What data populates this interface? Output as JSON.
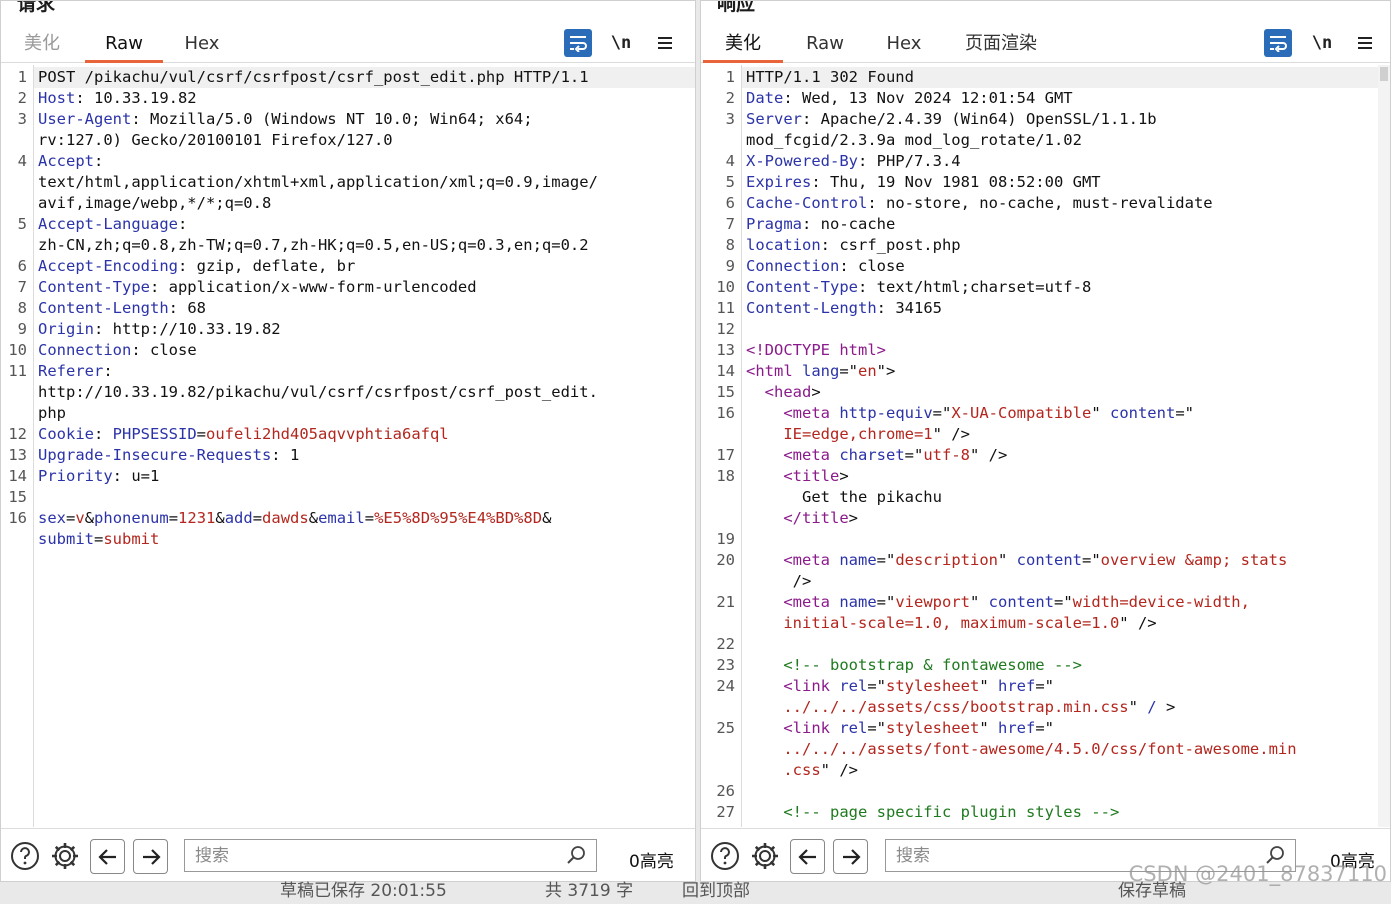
{
  "request": {
    "title": "请求",
    "tabs": [
      "美化",
      "Raw",
      "Hex"
    ],
    "active_tab": "Raw",
    "tool_newline": "\\n",
    "search_placeholder": "搜索",
    "highlight_count": "0高亮",
    "lines": [
      {
        "n": "1",
        "segs": [
          [
            "POST /pikachu/vul/csrf/csrfpost/csrf_post_edit.php HTTP/1.1",
            ""
          ]
        ]
      },
      {
        "n": "2",
        "segs": [
          [
            "Host",
            "hk"
          ],
          [
            ": 10.33.19.82",
            ""
          ]
        ]
      },
      {
        "n": "3",
        "segs": [
          [
            "User-Agent",
            "hk"
          ],
          [
            ": Mozilla/5.0 (Windows NT 10.0; Win64; x64;",
            ""
          ]
        ]
      },
      {
        "n": "",
        "segs": [
          [
            "rv:127.0) Gecko/20100101 Firefox/127.0",
            ""
          ]
        ]
      },
      {
        "n": "4",
        "segs": [
          [
            "Accept",
            "hk"
          ],
          [
            ":",
            ""
          ]
        ]
      },
      {
        "n": "",
        "segs": [
          [
            "text/html,application/xhtml+xml,application/xml;q=0.9,image/",
            ""
          ]
        ]
      },
      {
        "n": "",
        "segs": [
          [
            "avif,image/webp,*/*;q=0.8",
            ""
          ]
        ]
      },
      {
        "n": "5",
        "segs": [
          [
            "Accept-Language",
            "hk"
          ],
          [
            ":",
            ""
          ]
        ]
      },
      {
        "n": "",
        "segs": [
          [
            "zh-CN,zh;q=0.8,zh-TW;q=0.7,zh-HK;q=0.5,en-US;q=0.3,en;q=0.2",
            ""
          ]
        ]
      },
      {
        "n": "6",
        "segs": [
          [
            "Accept-Encoding",
            "hk"
          ],
          [
            ": gzip, deflate, br",
            ""
          ]
        ]
      },
      {
        "n": "7",
        "segs": [
          [
            "Content-Type",
            "hk"
          ],
          [
            ": application/x-www-form-urlencoded",
            ""
          ]
        ]
      },
      {
        "n": "8",
        "segs": [
          [
            "Content-Length",
            "hk"
          ],
          [
            ": 68",
            ""
          ]
        ]
      },
      {
        "n": "9",
        "segs": [
          [
            "Origin",
            "hk"
          ],
          [
            ": http://10.33.19.82",
            ""
          ]
        ]
      },
      {
        "n": "10",
        "segs": [
          [
            "Connection",
            "hk"
          ],
          [
            ": close",
            ""
          ]
        ]
      },
      {
        "n": "11",
        "segs": [
          [
            "Referer",
            "hk"
          ],
          [
            ":",
            ""
          ]
        ]
      },
      {
        "n": "",
        "segs": [
          [
            "http://10.33.19.82/pikachu/vul/csrf/csrfpost/csrf_post_edit.",
            ""
          ]
        ]
      },
      {
        "n": "",
        "segs": [
          [
            "php",
            ""
          ]
        ]
      },
      {
        "n": "12",
        "segs": [
          [
            "Cookie",
            "hk"
          ],
          [
            ": ",
            ""
          ],
          [
            "PHPSESSID",
            "pk"
          ],
          [
            "=",
            ""
          ],
          [
            "oufeli2hd405aqvvphtia6afql",
            "pv"
          ]
        ]
      },
      {
        "n": "13",
        "segs": [
          [
            "Upgrade-Insecure-Requests",
            "hk"
          ],
          [
            ": 1",
            ""
          ]
        ]
      },
      {
        "n": "14",
        "segs": [
          [
            "Priority",
            "hk"
          ],
          [
            ": u=1",
            ""
          ]
        ]
      },
      {
        "n": "15",
        "segs": [
          [
            "",
            ""
          ]
        ]
      },
      {
        "n": "16",
        "segs": [
          [
            "sex",
            "pk"
          ],
          [
            "=",
            ""
          ],
          [
            "v",
            "pv"
          ],
          [
            "&",
            ""
          ],
          [
            "phonenum",
            "pk"
          ],
          [
            "=",
            ""
          ],
          [
            "1231",
            "pv"
          ],
          [
            "&",
            ""
          ],
          [
            "add",
            "pk"
          ],
          [
            "=",
            ""
          ],
          [
            "dawds",
            "pv"
          ],
          [
            "&",
            ""
          ],
          [
            "email",
            "pk"
          ],
          [
            "=",
            ""
          ],
          [
            "%E5%8D%95%E4%BD%8D",
            "pv"
          ],
          [
            "&",
            ""
          ]
        ]
      },
      {
        "n": "",
        "segs": [
          [
            "submit",
            "pk"
          ],
          [
            "=",
            ""
          ],
          [
            "submit",
            "pv"
          ]
        ]
      }
    ]
  },
  "response": {
    "title": "响应",
    "tabs": [
      "美化",
      "Raw",
      "Hex",
      "页面渲染"
    ],
    "active_tab": "美化",
    "tool_newline": "\\n",
    "search_placeholder": "搜索",
    "highlight_count": "0高亮",
    "lines": [
      {
        "n": "1",
        "segs": [
          [
            "HTTP/1.1 302 Found",
            ""
          ]
        ]
      },
      {
        "n": "2",
        "segs": [
          [
            "Date",
            "hk"
          ],
          [
            ": Wed, 13 Nov 2024 12:01:54 GMT",
            ""
          ]
        ]
      },
      {
        "n": "3",
        "segs": [
          [
            "Server",
            "hk"
          ],
          [
            ": Apache/2.4.39 (Win64) OpenSSL/1.1.1b",
            ""
          ]
        ]
      },
      {
        "n": "",
        "segs": [
          [
            "mod_fcgid/2.3.9a mod_log_rotate/1.02",
            ""
          ]
        ]
      },
      {
        "n": "4",
        "segs": [
          [
            "X-Powered-By",
            "hk"
          ],
          [
            ": PHP/7.3.4",
            ""
          ]
        ]
      },
      {
        "n": "5",
        "segs": [
          [
            "Expires",
            "hk"
          ],
          [
            ": Thu, 19 Nov 1981 08:52:00 GMT",
            ""
          ]
        ]
      },
      {
        "n": "6",
        "segs": [
          [
            "Cache-Control",
            "hk"
          ],
          [
            ": no-store, no-cache, must-revalidate",
            ""
          ]
        ]
      },
      {
        "n": "7",
        "segs": [
          [
            "Pragma",
            "hk"
          ],
          [
            ": no-cache",
            ""
          ]
        ]
      },
      {
        "n": "8",
        "segs": [
          [
            "location",
            "hk"
          ],
          [
            ": csrf_post.php",
            ""
          ]
        ]
      },
      {
        "n": "9",
        "segs": [
          [
            "Connection",
            "hk"
          ],
          [
            ": close",
            ""
          ]
        ]
      },
      {
        "n": "10",
        "segs": [
          [
            "Content-Type",
            "hk"
          ],
          [
            ": text/html;charset=utf-8",
            ""
          ]
        ]
      },
      {
        "n": "11",
        "segs": [
          [
            "Content-Length",
            "hk"
          ],
          [
            ": 34165",
            ""
          ]
        ]
      },
      {
        "n": "12",
        "segs": [
          [
            "",
            ""
          ]
        ]
      },
      {
        "n": "13",
        "segs": [
          [
            "<!DOCTYPE html>",
            "tg"
          ]
        ]
      },
      {
        "n": "14",
        "segs": [
          [
            "<html ",
            "tg"
          ],
          [
            "lang",
            "at"
          ],
          [
            "=\"",
            ""
          ],
          [
            "en",
            "av"
          ],
          [
            "\">",
            ""
          ]
        ]
      },
      {
        "n": "15",
        "segs": [
          [
            "  ",
            ""
          ],
          [
            "<head",
            "tg"
          ],
          [
            ">",
            ""
          ]
        ]
      },
      {
        "n": "16",
        "segs": [
          [
            "    ",
            ""
          ],
          [
            "<meta ",
            "tg"
          ],
          [
            "http-equiv",
            "at"
          ],
          [
            "=\"",
            ""
          ],
          [
            "X-UA-Compatible",
            "av"
          ],
          [
            "\" ",
            ""
          ],
          [
            "content",
            "at"
          ],
          [
            "=\"",
            ""
          ]
        ]
      },
      {
        "n": "",
        "segs": [
          [
            "    ",
            ""
          ],
          [
            "IE=edge,chrome=1",
            "av"
          ],
          [
            "\" />",
            ""
          ]
        ]
      },
      {
        "n": "17",
        "segs": [
          [
            "    ",
            ""
          ],
          [
            "<meta ",
            "tg"
          ],
          [
            "charset",
            "at"
          ],
          [
            "=\"",
            ""
          ],
          [
            "utf-8",
            "av"
          ],
          [
            "\" />",
            ""
          ]
        ]
      },
      {
        "n": "18",
        "segs": [
          [
            "    ",
            ""
          ],
          [
            "<title",
            "tg"
          ],
          [
            ">",
            ""
          ]
        ]
      },
      {
        "n": "",
        "segs": [
          [
            "      Get the pikachu",
            ""
          ]
        ]
      },
      {
        "n": "",
        "segs": [
          [
            "    ",
            ""
          ],
          [
            "</title",
            "tg"
          ],
          [
            ">",
            ""
          ]
        ]
      },
      {
        "n": "19",
        "segs": [
          [
            "",
            ""
          ]
        ]
      },
      {
        "n": "20",
        "segs": [
          [
            "    ",
            ""
          ],
          [
            "<meta ",
            "tg"
          ],
          [
            "name",
            "at"
          ],
          [
            "=\"",
            ""
          ],
          [
            "description",
            "av"
          ],
          [
            "\" ",
            ""
          ],
          [
            "content",
            "at"
          ],
          [
            "=\"",
            ""
          ],
          [
            "overview &amp; stats",
            "av"
          ]
        ]
      },
      {
        "n": "",
        "segs": [
          [
            "     />",
            ""
          ]
        ]
      },
      {
        "n": "21",
        "segs": [
          [
            "    ",
            ""
          ],
          [
            "<meta ",
            "tg"
          ],
          [
            "name",
            "at"
          ],
          [
            "=\"",
            ""
          ],
          [
            "viewport",
            "av"
          ],
          [
            "\" ",
            ""
          ],
          [
            "content",
            "at"
          ],
          [
            "=\"",
            ""
          ],
          [
            "width=device-width,",
            "av"
          ]
        ]
      },
      {
        "n": "",
        "segs": [
          [
            "    ",
            ""
          ],
          [
            "initial-scale=1.0, maximum-scale=1.0",
            "av"
          ],
          [
            "\" />",
            ""
          ]
        ]
      },
      {
        "n": "22",
        "segs": [
          [
            "",
            ""
          ]
        ]
      },
      {
        "n": "23",
        "segs": [
          [
            "    ",
            ""
          ],
          [
            "<!-- bootstrap & fontawesome -->",
            "cm"
          ]
        ]
      },
      {
        "n": "24",
        "segs": [
          [
            "    ",
            ""
          ],
          [
            "<link ",
            "tg"
          ],
          [
            "rel",
            "at"
          ],
          [
            "=\"",
            ""
          ],
          [
            "stylesheet",
            "av"
          ],
          [
            "\" ",
            ""
          ],
          [
            "href",
            "at"
          ],
          [
            "=\"",
            ""
          ]
        ]
      },
      {
        "n": "",
        "segs": [
          [
            "    ",
            ""
          ],
          [
            "../../../assets/css/bootstrap.min.css",
            "av"
          ],
          [
            "\" ",
            ""
          ],
          [
            "/",
            "at"
          ],
          [
            " >",
            ""
          ]
        ]
      },
      {
        "n": "25",
        "segs": [
          [
            "    ",
            ""
          ],
          [
            "<link ",
            "tg"
          ],
          [
            "rel",
            "at"
          ],
          [
            "=\"",
            ""
          ],
          [
            "stylesheet",
            "av"
          ],
          [
            "\" ",
            ""
          ],
          [
            "href",
            "at"
          ],
          [
            "=\"",
            ""
          ]
        ]
      },
      {
        "n": "",
        "segs": [
          [
            "    ",
            ""
          ],
          [
            "../../../assets/font-awesome/4.5.0/css/font-awesome.min",
            "av"
          ]
        ]
      },
      {
        "n": "",
        "segs": [
          [
            "    ",
            ""
          ],
          [
            ".css",
            "av"
          ],
          [
            "\" />",
            ""
          ]
        ]
      },
      {
        "n": "26",
        "segs": [
          [
            "",
            ""
          ]
        ]
      },
      {
        "n": "27",
        "segs": [
          [
            "    ",
            ""
          ],
          [
            "<!-- page specific plugin styles -->",
            "cm"
          ]
        ]
      }
    ]
  },
  "background": {
    "status_saved": "草稿已保存 20:01:55",
    "word_count": "共 3719 字",
    "back_to_top": "回到顶部",
    "save_draft": "保存草稿",
    "watermark": "CSDN @2401_87837110"
  }
}
